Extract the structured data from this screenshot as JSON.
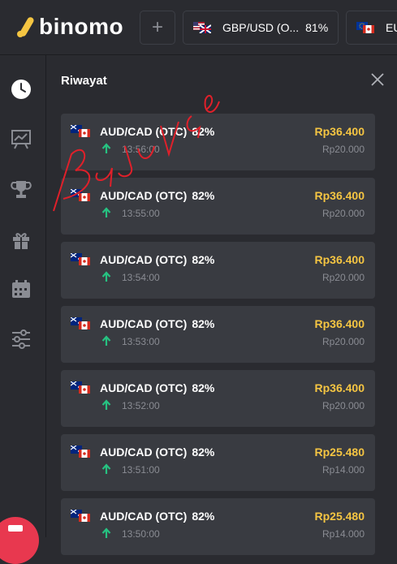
{
  "brand": {
    "logo_text": "binomo"
  },
  "topbar": {
    "add_label": "+",
    "tabs": [
      {
        "pair": "GBP/USD (O...",
        "percent": "81%"
      },
      {
        "pair": "EU",
        "percent": ""
      }
    ]
  },
  "panel": {
    "title": "Riwayat",
    "trades": [
      {
        "pair": "AUD/CAD (OTC)",
        "percent": "82%",
        "time": "13:56:00",
        "payout": "Rp36.400",
        "amount": "Rp20.000"
      },
      {
        "pair": "AUD/CAD (OTC)",
        "percent": "82%",
        "time": "13:55:00",
        "payout": "Rp36.400",
        "amount": "Rp20.000"
      },
      {
        "pair": "AUD/CAD (OTC)",
        "percent": "82%",
        "time": "13:54:00",
        "payout": "Rp36.400",
        "amount": "Rp20.000"
      },
      {
        "pair": "AUD/CAD (OTC)",
        "percent": "82%",
        "time": "13:53:00",
        "payout": "Rp36.400",
        "amount": "Rp20.000"
      },
      {
        "pair": "AUD/CAD (OTC)",
        "percent": "82%",
        "time": "13:52:00",
        "payout": "Rp36.400",
        "amount": "Rp20.000"
      },
      {
        "pair": "AUD/CAD (OTC)",
        "percent": "82%",
        "time": "13:51:00",
        "payout": "Rp25.480",
        "amount": "Rp14.000"
      },
      {
        "pair": "AUD/CAD (OTC)",
        "percent": "82%",
        "time": "13:50:00",
        "payout": "Rp25.480",
        "amount": "Rp14.000"
      }
    ]
  },
  "colors": {
    "accent": "#f5c542",
    "up": "#26c281",
    "brand": "#f5c542",
    "background": "#2a2b30",
    "card": "#393b41"
  },
  "icons": [
    "clock-icon",
    "chart-board-icon",
    "trophy-icon",
    "gift-icon",
    "calendar-icon",
    "sliders-icon",
    "close-icon",
    "arrow-up-icon"
  ]
}
